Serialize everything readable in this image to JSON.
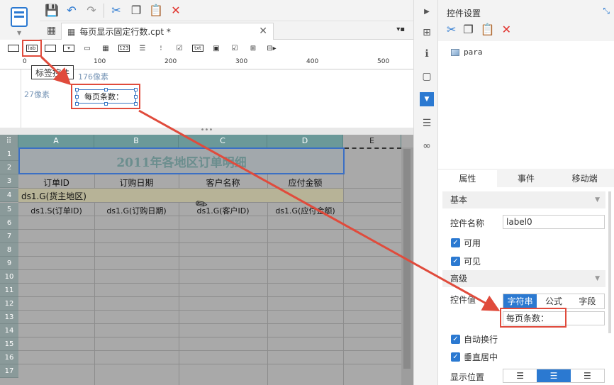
{
  "toolbar": {
    "save_icon": "save-icon",
    "undo_icon": "undo-icon",
    "redo_icon": "redo-icon",
    "cut_icon": "cut-icon",
    "copy_icon": "copy-icon",
    "paste_icon": "paste-icon",
    "delete_icon": "delete-icon"
  },
  "tab": {
    "label": "每页显示固定行数.cpt *"
  },
  "widget_toolbar": {
    "label_button": "lab",
    "text_button": "txt",
    "num_button": "123"
  },
  "tooltip": "标签控件",
  "ruler": {
    "ticks": [
      "0",
      "100",
      "200",
      "300",
      "400",
      "500"
    ]
  },
  "canvas": {
    "width_label": "176像素",
    "height_label": "27像素",
    "label_widget_text": "每页条数："
  },
  "sheet": {
    "columns": [
      "A",
      "B",
      "C",
      "D",
      "E"
    ],
    "rows": [
      "1 {H}",
      "2 {H}",
      "3 {H}",
      "4 {H}",
      "5",
      "6",
      "7",
      "8",
      "9",
      "10",
      "11",
      "12",
      "13",
      "14",
      "15",
      "16",
      "17"
    ],
    "title": "2011年各地区订单明细",
    "headers": [
      "订单ID",
      "订购日期",
      "客户名称",
      "应付金额"
    ],
    "group_cell": "ds1.G(货主地区)",
    "data_cells": [
      "ds1.S(订单ID)",
      "ds1.G(订购日期)",
      "ds1.G(客户ID)",
      "ds1.G(应付金额)"
    ]
  },
  "panel": {
    "title": "控件设置",
    "tree_node": "para",
    "tabs": [
      "属性",
      "事件",
      "移动端"
    ],
    "section_basic": "基本",
    "name_label": "控件名称",
    "name_value": "label0",
    "enabled_label": "可用",
    "visible_label": "可见",
    "section_advanced": "高级",
    "value_label": "控件值",
    "value_modes": [
      "字符串",
      "公式",
      "字段"
    ],
    "value_text": "每页条数：",
    "wrap_label": "自动换行",
    "vcenter_label": "垂直居中",
    "align_label": "显示位置"
  },
  "colors": {
    "accent": "#2b79d1",
    "highlight": "#e04b3c",
    "header": "#6b9999"
  }
}
